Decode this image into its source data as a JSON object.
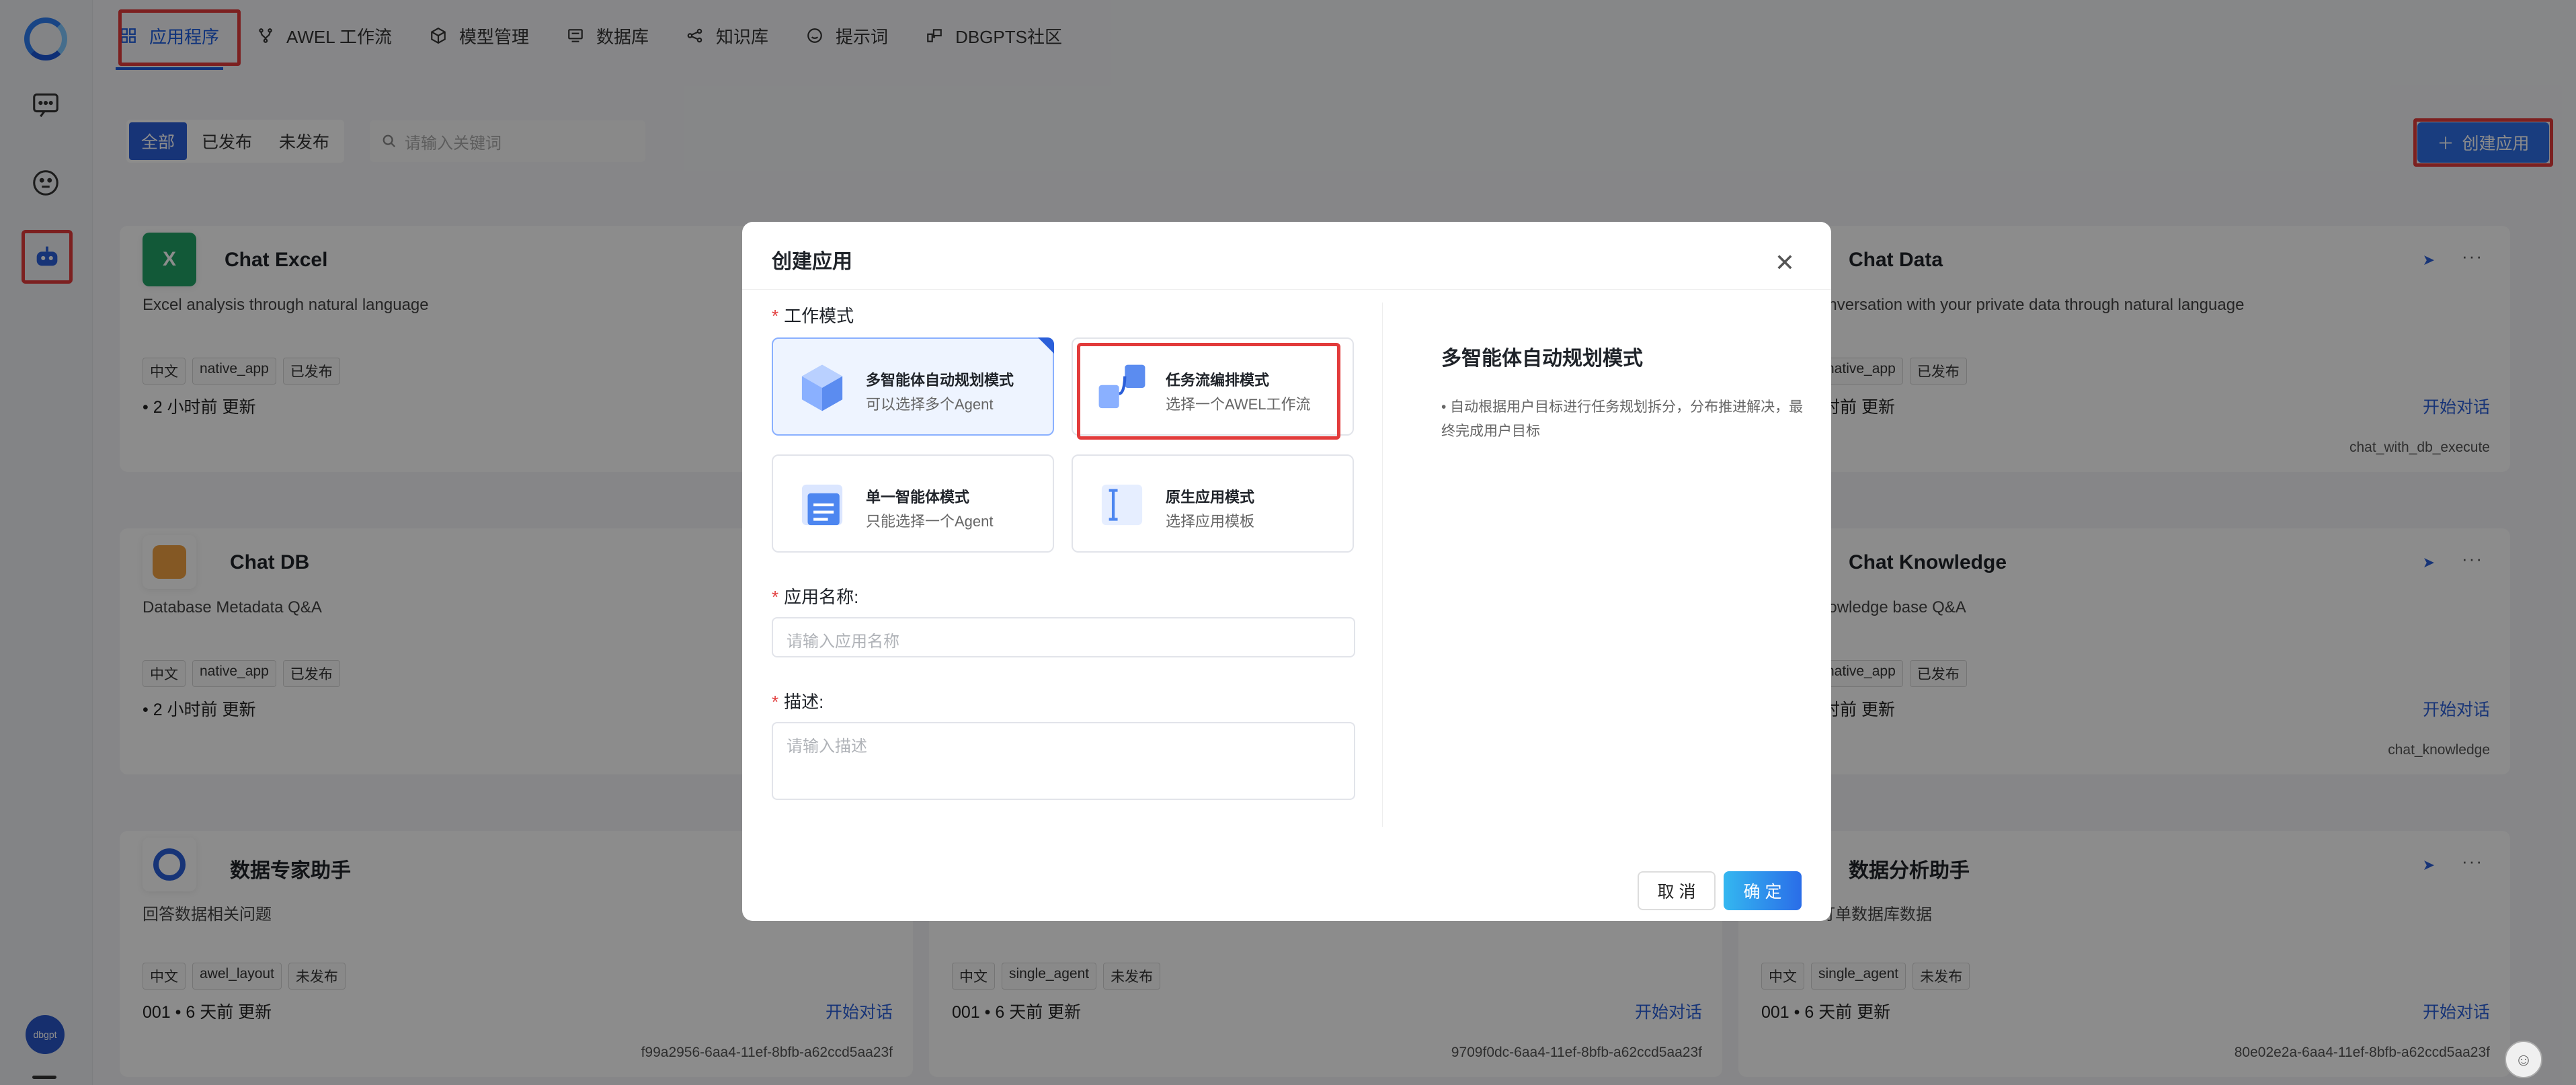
{
  "nav": {
    "items": [
      {
        "label": "应用程序",
        "icon": "grid-icon"
      },
      {
        "label": "AWEL 工作流",
        "icon": "flow-icon"
      },
      {
        "label": "模型管理",
        "icon": "cube-icon"
      },
      {
        "label": "数据库",
        "icon": "database-icon"
      },
      {
        "label": "知识库",
        "icon": "share-icon"
      },
      {
        "label": "提示词",
        "icon": "smile-icon"
      },
      {
        "label": "DBGPTS社区",
        "icon": "community-icon"
      }
    ]
  },
  "filter": {
    "all": "全部",
    "published": "已发布",
    "unpublished": "未发布",
    "search_placeholder": "请输入关键词"
  },
  "create_button": "创建应用",
  "avatar_text": "dbgpt",
  "cards": [
    {
      "title": "Chat Excel",
      "desc": "Excel analysis through natural language",
      "tags": [
        "中文",
        "native_app",
        "已发布"
      ],
      "meta": "• 2 小时前 更新",
      "chat": "",
      "code": "",
      "icon_letter": "X",
      "icon_color": "#21a366"
    },
    {
      "title": "Chat Data",
      "desc": "onversation with your private data through natural language",
      "tags": [
        "native_app",
        "已发布"
      ],
      "meta": "时前 更新",
      "chat": "开始对话",
      "code": "chat_with_db_execute",
      "icon_letter": "",
      "icon_color": ""
    },
    {
      "title": "Chat DB",
      "desc": "Database Metadata Q&A",
      "tags": [
        "中文",
        "native_app",
        "已发布"
      ],
      "meta": "• 2 小时前 更新",
      "chat": "",
      "code": "",
      "icon_letter": "",
      "icon_color": "#f0a142"
    },
    {
      "title": "Chat Knowledge",
      "desc": "nowledge base Q&A",
      "tags": [
        "native_app",
        "已发布"
      ],
      "meta": "时前 更新",
      "chat": "开始对话",
      "code": "chat_knowledge",
      "icon_letter": "",
      "icon_color": ""
    },
    {
      "title": "数据专家助手",
      "desc": "回答数据相关问题",
      "tags": [
        "中文",
        "awel_layout",
        "未发布"
      ],
      "meta": "001 • 6 天前 更新",
      "chat": "开始对话",
      "code": "f99a2956-6aa4-11ef-8bfb-a62ccd5aa23f",
      "icon_letter": "",
      "icon_color": "#2b5fd9"
    },
    {
      "title": "",
      "desc": "",
      "tags": [
        "中文",
        "single_agent",
        "未发布"
      ],
      "meta": "001 • 6 天前 更新",
      "chat": "开始对话",
      "code": "9709f0dc-6aa4-11ef-8bfb-a62ccd5aa23f",
      "icon_letter": "",
      "icon_color": ""
    },
    {
      "title": "数据分析助手",
      "desc": "订单数据库数据",
      "tags": [
        "中文",
        "single_agent",
        "未发布"
      ],
      "meta": "001 • 6 天前 更新",
      "chat": "开始对话",
      "code": "80e02e2a-6aa4-11ef-8bfb-a62ccd5aa23f",
      "icon_letter": "",
      "icon_color": ""
    }
  ],
  "modal": {
    "title": "创建应用",
    "work_mode_label": "工作模式",
    "modes": [
      {
        "name": "多智能体自动规划模式",
        "sub": "可以选择多个Agent"
      },
      {
        "name": "任务流编排模式",
        "sub": "选择一个AWEL工作流"
      },
      {
        "name": "单一智能体模式",
        "sub": "只能选择一个Agent"
      },
      {
        "name": "原生应用模式",
        "sub": "选择应用模板"
      }
    ],
    "name_label": "应用名称:",
    "name_placeholder": "请输入应用名称",
    "desc_label": "描述:",
    "desc_placeholder": "请输入描述",
    "side_title": "多智能体自动规划模式",
    "side_text": "• 自动根据用户目标进行任务规划拆分，分布推进解决，最终完成用户目标",
    "cancel": "取 消",
    "ok": "确 定"
  }
}
